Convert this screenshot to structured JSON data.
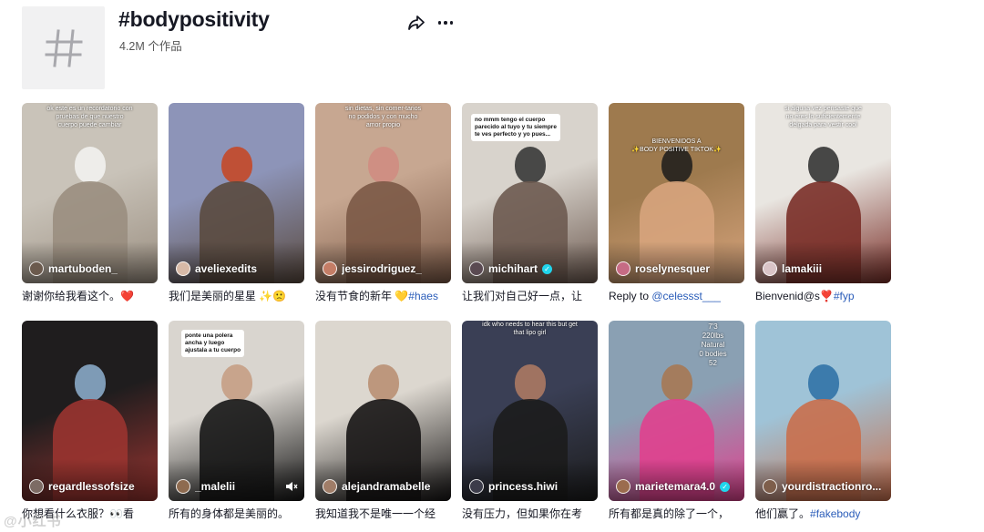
{
  "header": {
    "title": "#bodypositivity",
    "count": "4.2M 个作品"
  },
  "videos": [
    {
      "author": "martuboden_",
      "verified": false,
      "caption": "谢谢你给我看这个。",
      "caption_tag": "",
      "caption_emoji": "❤️",
      "overlay": "ok este es un recordatorio con\npruebas de que nuestro\ncuerpo puede cambiar",
      "colors": [
        "#c9c3b9",
        "#9a8e80",
        "#f4f4f2"
      ],
      "avatar_color": "#6b5a4d"
    },
    {
      "author": "aveliexedits",
      "verified": false,
      "caption": "我们是美丽的星星 ",
      "caption_tag": "",
      "caption_emoji": "✨🙁",
      "overlay": "",
      "colors": [
        "#8d94b8",
        "#5a4a3f",
        "#c8441e"
      ],
      "avatar_color": "#d7b9a7"
    },
    {
      "author": "jessirodriguez_",
      "verified": false,
      "caption": "没有节食的新年 💛",
      "caption_tag": "#haes",
      "caption_emoji": "",
      "overlay": "sin dietas, sin comer-tarios\nno podidos y con mucho\namor propio",
      "colors": [
        "#c7a791",
        "#7b5946",
        "#d08b80"
      ],
      "avatar_color": "#c47d66"
    },
    {
      "author": "michihart",
      "verified": true,
      "caption": "让我们对自己好一点，让",
      "caption_tag": "",
      "caption_emoji": "",
      "overlay": "no mmm tengo el cuerpo\nparecido al tuyo y tu siempre\nte ves perfecto y yo pues...",
      "colors": [
        "#d8d3cc",
        "#6d5a50",
        "#2f2f2f"
      ],
      "avatar_color": "#5a4a52"
    },
    {
      "author": "roselynesquer",
      "verified": false,
      "caption": "Reply to ",
      "caption_tag": "@celessst___",
      "caption_emoji": "",
      "overlay": "BIENVENIDOS A\n✨BODY POSITIVE TIKTOK✨",
      "colors": [
        "#9e7a4e",
        "#d7a47d",
        "#1b1b1b"
      ],
      "avatar_color": "#c66b84"
    },
    {
      "author": "lamakiii",
      "verified": false,
      "caption": "Bienvenid@s",
      "caption_tag": "#fyp",
      "caption_emoji": "❣️",
      "overlay": "si alguna vez pensaste que\nno eres lo suficientemente\ndelgada para vestir cool",
      "colors": [
        "#e9e6e1",
        "#7a2f28",
        "#2a2a2a"
      ],
      "avatar_color": "#d9c4c7"
    },
    {
      "author": "regardlessofsize",
      "verified": false,
      "caption": "你想看什么衣服？👀看",
      "caption_tag": "",
      "caption_emoji": "",
      "overlay": "",
      "colors": [
        "#1f1d1e",
        "#9a3430",
        "#8fb1d1"
      ],
      "avatar_color": "#7c6b64"
    },
    {
      "author": "_malelii",
      "verified": false,
      "caption": "所有的身体都是美丽的。",
      "caption_tag": "",
      "caption_emoji": "",
      "overlay": "ponte una polera\nancha y luego\najustala a tu cuerpo",
      "colors": [
        "#d9d5cf",
        "#161616",
        "#c49b80"
      ],
      "avatar_color": "#8e6b50"
    },
    {
      "author": "alejandramabelle",
      "verified": false,
      "caption": "我知道我不是唯一一个经",
      "caption_tag": "",
      "caption_emoji": "",
      "overlay": "",
      "colors": [
        "#dcd7cf",
        "#171515",
        "#b78c6f"
      ],
      "avatar_color": "#a07d68"
    },
    {
      "author": "princess.hiwi",
      "verified": false,
      "caption": "没有压力，但如果你在考",
      "caption_tag": "",
      "caption_emoji": "",
      "overlay": "idk who needs to hear this but get\nthat lipo girl",
      "colors": [
        "#3a3f55",
        "#1c1c1c",
        "#b37d64"
      ],
      "avatar_color": "#3c3c4a"
    },
    {
      "author": "marietemara4.0",
      "verified": true,
      "caption": "所有都是真的除了一个，",
      "caption_tag": "",
      "caption_emoji": "",
      "overlay": "7'3\n220lbs\nNatural\n0 bodies\n52",
      "colors": [
        "#8aa0b3",
        "#e0408e",
        "#a8754e"
      ],
      "avatar_color": "#9b6c4e"
    },
    {
      "author": "yourdistractionro...",
      "verified": false,
      "caption": "他们赢了。",
      "caption_tag": "#fakebody",
      "caption_emoji": "",
      "overlay": "",
      "colors": [
        "#9fc3d7",
        "#c96f4c",
        "#2a6fa4"
      ],
      "avatar_color": "#7e5e4b"
    }
  ],
  "watermark": "@小红书"
}
